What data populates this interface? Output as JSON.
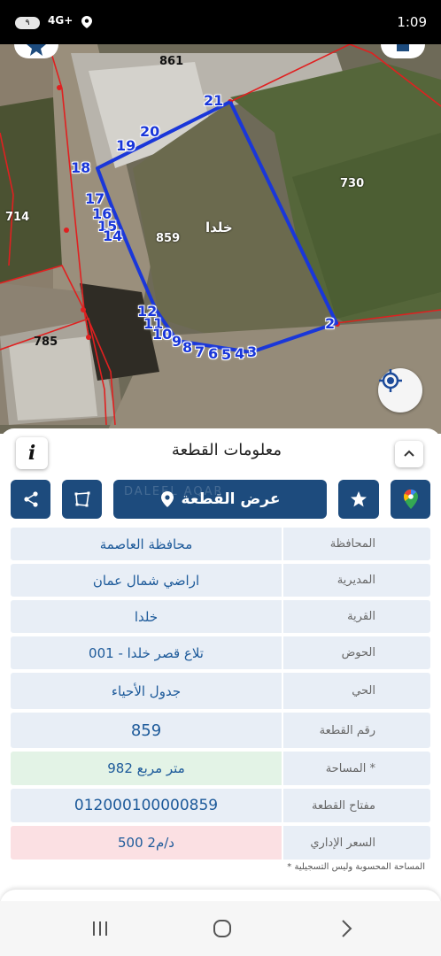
{
  "status": {
    "time": "1:09",
    "battery": "٩",
    "network": "4G+"
  },
  "map": {
    "labels": {
      "p861": "861",
      "p730": "730",
      "p714": "714",
      "p859": "859",
      "p785": "785",
      "area_name": "خلدا"
    },
    "vertices": [
      "21",
      "20",
      "19",
      "18",
      "17",
      "16",
      "15",
      "14",
      "12",
      "11",
      "10",
      "9",
      "8",
      "7",
      "6",
      "5",
      "4",
      "3",
      "2"
    ]
  },
  "panel": {
    "title": "معلومات القطعة",
    "info_icon": "i",
    "show_parcel": "عرض القطعة",
    "watermark": "DALEEL AQAR",
    "rows": [
      {
        "key": "المحافظة",
        "value": "محافظة العاصمة"
      },
      {
        "key": "المديرية",
        "value": "اراضي شمال عمان"
      },
      {
        "key": "القرية",
        "value": "خلدا"
      },
      {
        "key": "الحوض",
        "value": "تلاع قصر خلدا - 001"
      },
      {
        "key": "الحي",
        "value": "جدول الأحياء"
      },
      {
        "key": "رقم القطعة",
        "value": "859"
      },
      {
        "key": "المساحة *",
        "value": "982  متر مربع"
      },
      {
        "key": "مفتاح القطعة",
        "value": "012000100000859"
      },
      {
        "key": "السعر الإداري",
        "value": "500 د/م2"
      }
    ],
    "footnote": "* المساحة المحسوبة وليس التسجيلية"
  },
  "colors": {
    "primary": "#1d4b7d",
    "parcel_outline": "#1a37d9",
    "boundary": "#e02020"
  }
}
